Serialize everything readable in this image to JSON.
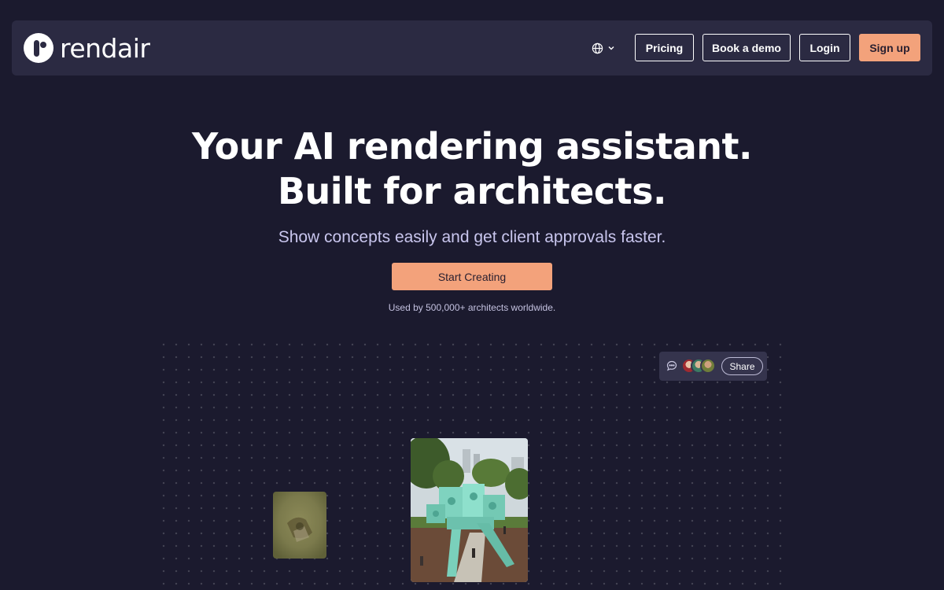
{
  "brand": {
    "name": "rendair"
  },
  "nav": {
    "language_icon": "globe-icon",
    "language_chevron_icon": "chevron-down-icon",
    "pricing": "Pricing",
    "book_demo": "Book a demo",
    "login": "Login",
    "signup": "Sign up"
  },
  "hero": {
    "title_line1": "Your AI rendering assistant.",
    "title_line2": "Built for architects.",
    "subtitle": "Show concepts easily and get client approvals faster.",
    "cta": "Start Creating",
    "social_proof": "Used by 500,000+ architects worldwide."
  },
  "canvas": {
    "chat_icon": "chat-bubble-icon",
    "share_label": "Share"
  },
  "colors": {
    "background": "#1b1a2e",
    "navbar": "#2b2a42",
    "accent": "#f3a27b",
    "subtitle": "#c9c6ee"
  }
}
